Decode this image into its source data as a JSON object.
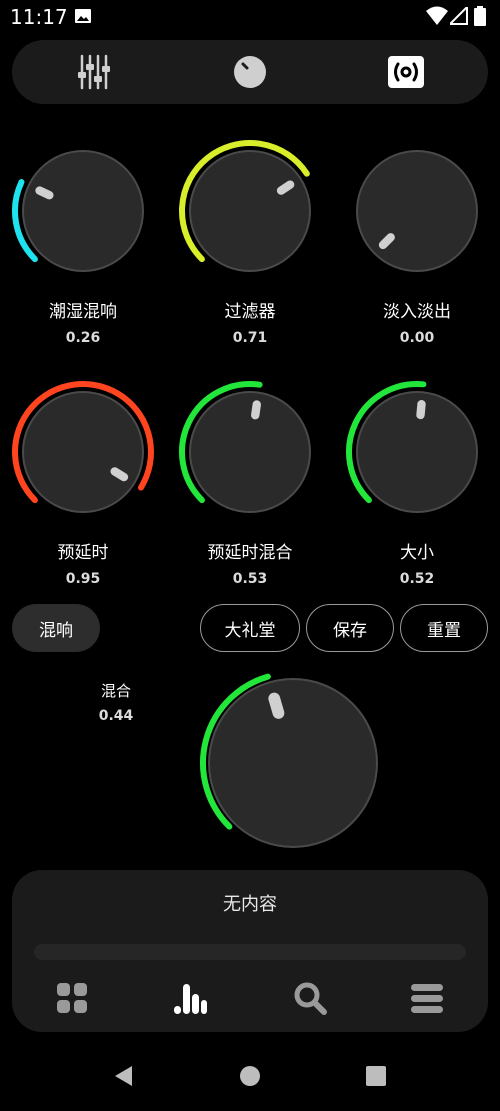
{
  "status_bar": {
    "time": "11:17",
    "icons": [
      "gallery-icon",
      "wifi-icon",
      "cell-signal-icon",
      "battery-icon"
    ]
  },
  "top_tabs": [
    {
      "name": "equalizer",
      "icon": "equalizer-sliders-icon"
    },
    {
      "name": "bass",
      "icon": "knob-icon"
    },
    {
      "name": "reverb",
      "icon": "surround-icon",
      "active": true
    }
  ],
  "knobs": [
    {
      "label": "潮湿混响",
      "value": "0.26",
      "level": 0.26,
      "color": "#1ee3ee"
    },
    {
      "label": "过滤器",
      "value": "0.71",
      "level": 0.71,
      "color": "#d8ee2a"
    },
    {
      "label": "淡入淡出",
      "value": "0.00",
      "level": 0.0,
      "color": "#1ee3ee"
    },
    {
      "label": "预延时",
      "value": "0.95",
      "level": 0.95,
      "color": "#ff4420"
    },
    {
      "label": "预延时混合",
      "value": "0.53",
      "level": 0.53,
      "color": "#22e63a"
    },
    {
      "label": "大小",
      "value": "0.52",
      "level": 0.52,
      "color": "#22e63a"
    }
  ],
  "mix_knob": {
    "label": "混合",
    "value": "0.44",
    "level": 0.44,
    "color": "#22e63a"
  },
  "buttons": {
    "reverb_toggle": "混响",
    "preset": "大礼堂",
    "save": "保存",
    "reset": "重置"
  },
  "player": {
    "empty_text": "无内容",
    "progress": 0.0,
    "nav": [
      "grid-icon",
      "bars-icon",
      "search-icon",
      "menu-icon"
    ],
    "active_nav": "bars-icon"
  },
  "system_nav": [
    "back-icon",
    "home-icon",
    "recents-icon"
  ],
  "colors": {
    "background": "#000000",
    "panel": "#1b1b1b",
    "knob_face": "#2a2a2a"
  }
}
